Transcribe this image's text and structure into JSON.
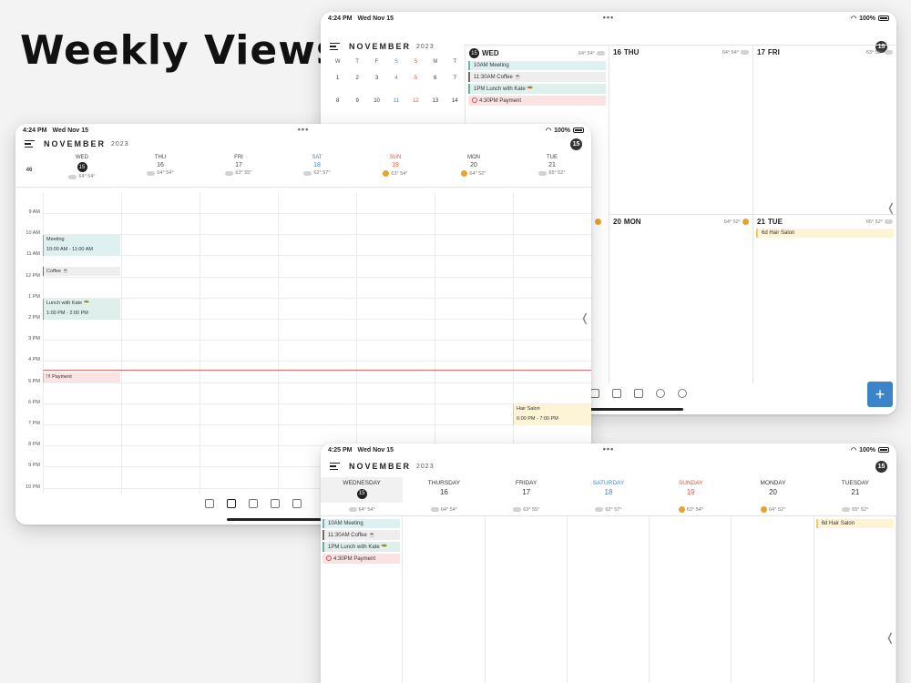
{
  "headline": "Weekly Views",
  "common": {
    "month": "NOVEMBER",
    "year": "2023",
    "today_badge": "15",
    "date": "Wed Nov 15",
    "battery": "100%",
    "dots": "•••",
    "chevron": "❬"
  },
  "devA": {
    "time": "4:24 PM",
    "mini_days": [
      "W",
      "T",
      "F",
      "S",
      "S",
      "M",
      "T"
    ],
    "mini_rows": [
      [
        "1",
        "2",
        "3",
        "4",
        "5",
        "6",
        "7"
      ],
      [
        "8",
        "9",
        "10",
        "11",
        "12",
        "13",
        "14"
      ]
    ],
    "cells": [
      {
        "num": "15",
        "name": "WED",
        "temp": "64° 54°",
        "today": true
      },
      {
        "num": "16",
        "name": "THU",
        "temp": "64° 54°"
      },
      {
        "num": "17",
        "name": "FRI",
        "temp": "63° 55°"
      },
      {
        "num": "20",
        "name": "MON",
        "temp": "64° 52°"
      },
      {
        "num": "21",
        "name": "TUE",
        "temp": "65° 52°"
      }
    ],
    "events_wed": [
      "10AM Meeting",
      "11:30AM Coffee ☕",
      "1PM Lunch with Kate 🥗",
      "4:30PM Payment"
    ],
    "events_tue": [
      "6d Hair Salon"
    ],
    "fab": "+"
  },
  "devB": {
    "time": "4:24 PM",
    "week_number": "46",
    "days": [
      {
        "name": "WED",
        "num": "15",
        "temp": "64° 54°"
      },
      {
        "name": "THU",
        "num": "16",
        "temp": "64° 54°"
      },
      {
        "name": "FRI",
        "num": "17",
        "temp": "63° 55°"
      },
      {
        "name": "SAT",
        "num": "18",
        "temp": "62° 57°"
      },
      {
        "name": "SUN",
        "num": "19",
        "temp": "63° 54°"
      },
      {
        "name": "MON",
        "num": "20",
        "temp": "64° 52°"
      },
      {
        "name": "TUE",
        "num": "21",
        "temp": "65° 52°"
      }
    ],
    "hours": [
      "9 AM",
      "10 AM",
      "11 AM",
      "12 PM",
      "1 PM",
      "2 PM",
      "3 PM",
      "4 PM",
      "5 PM",
      "6 PM",
      "7 PM",
      "8 PM",
      "9 PM",
      "10 PM"
    ],
    "events": {
      "meeting_title": "Meeting",
      "meeting_time": "10:00 AM - 11:00 AM",
      "coffee": "Coffee ☕",
      "lunch_title": "Lunch with Kate 🥗",
      "lunch_time": "1:00 PM - 2:00 PM",
      "payment": "!!! Payment",
      "salon_title": "Hair Salon",
      "salon_time": "6:00 PM - 7:00 PM"
    }
  },
  "devC": {
    "time": "4:25 PM",
    "days": [
      {
        "name": "WEDNESDAY",
        "num": "15",
        "temp": "64° 54°"
      },
      {
        "name": "THURSDAY",
        "num": "16",
        "temp": "64° 54°"
      },
      {
        "name": "FRIDAY",
        "num": "17",
        "temp": "63° 55°"
      },
      {
        "name": "SATURDAY",
        "num": "18",
        "temp": "62° 57°"
      },
      {
        "name": "SUNDAY",
        "num": "19",
        "temp": "63° 54°"
      },
      {
        "name": "MONDAY",
        "num": "20",
        "temp": "64° 52°"
      },
      {
        "name": "TUESDAY",
        "num": "21",
        "temp": "65° 52°"
      }
    ],
    "events_wed": [
      "10AM Meeting",
      "11:30AM Coffee ☕",
      "1PM Lunch with Kate 🥗",
      "4:30PM Payment"
    ],
    "events_tue": [
      "6d Hair Salon"
    ]
  }
}
